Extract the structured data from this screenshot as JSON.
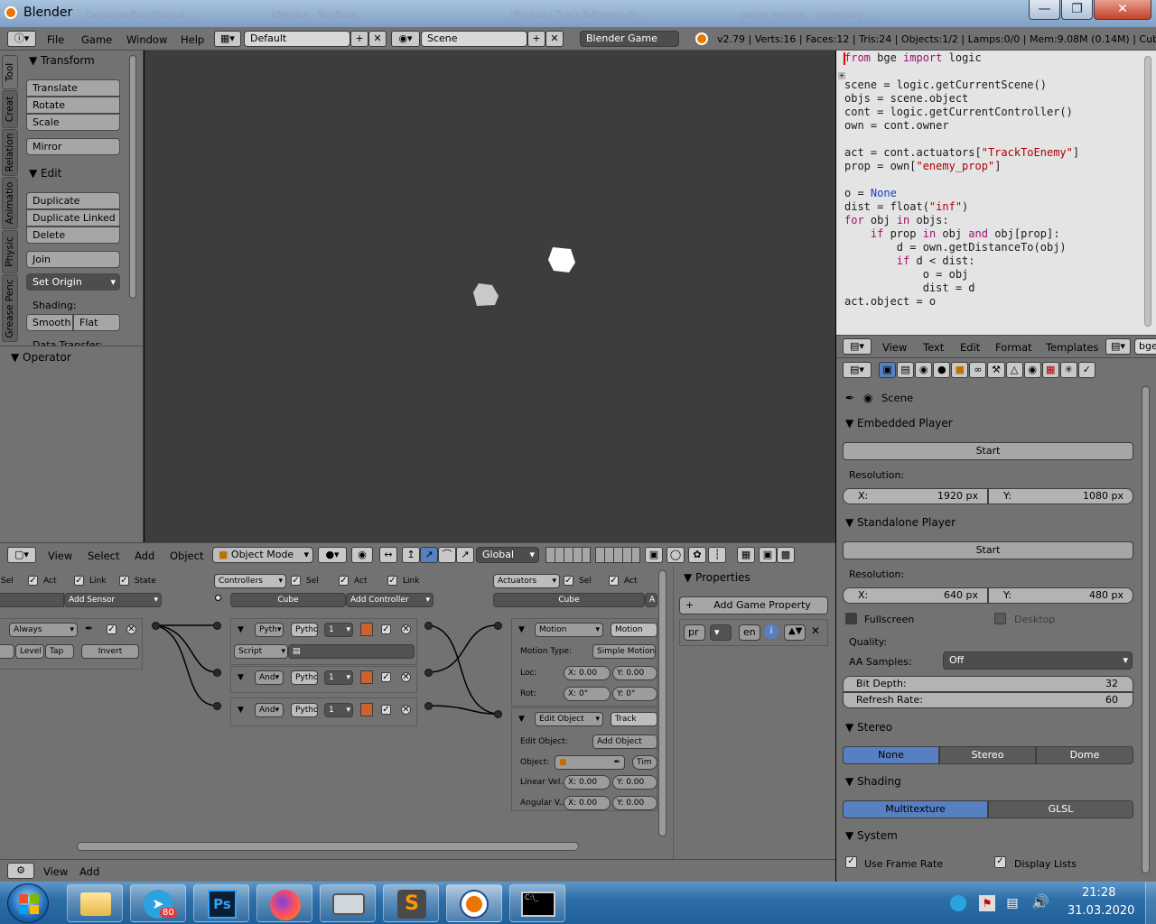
{
  "window": {
    "title": "Blender",
    "ghost_tabs": [
      "Dowolne/fontFallout ...",
      "VMedia - YouTube",
      "[Python] TrackToEnemy/b ...",
      "game engine - Inventory ..."
    ]
  },
  "menu": {
    "items": [
      "File",
      "Game",
      "Window",
      "Help"
    ]
  },
  "header": {
    "layout": "Default",
    "scene": "Scene",
    "engine": "Blender Game",
    "stats": "v2.79 | Verts:16 | Faces:12 | Tris:24 | Objects:1/2 | Lamps:0/0 | Mem:9.08M (0.14M) | Cube"
  },
  "toolshelf": {
    "tabs": [
      "Tool",
      "Creat",
      "Relation",
      "Animatio",
      "Physic",
      "Grease Penc"
    ],
    "transform": {
      "title": "Transform",
      "buttons": [
        "Translate",
        "Rotate",
        "Scale",
        "Mirror"
      ]
    },
    "edit": {
      "title": "Edit",
      "buttons": [
        "Duplicate",
        "Duplicate Linked",
        "Delete",
        "Join"
      ],
      "set_origin": "Set Origin"
    },
    "shading": {
      "label": "Shading:",
      "smooth": "Smooth",
      "flat": "Flat"
    },
    "data_transfer": "Data Transfer:",
    "operator": "Operator"
  },
  "viewport_header": {
    "menus": [
      "View",
      "Select",
      "Add",
      "Object"
    ],
    "mode": "Object Mode",
    "orientation": "Global"
  },
  "logic": {
    "sensors": {
      "sel": "Sel",
      "act": "Act",
      "link": "Link",
      "state": "State",
      "add": "Add Sensor",
      "always": "Always",
      "level": "Level",
      "tap": "Tap",
      "invert": "Invert"
    },
    "controllers": {
      "header": "Controllers",
      "sel": "Sel",
      "act": "Act",
      "link": "Link",
      "object": "Cube",
      "add": "Add Controller",
      "items": [
        {
          "type": "Pyth",
          "name": "Pytho",
          "num": "1"
        },
        {
          "type": "And",
          "name": "Pytho",
          "num": "1"
        },
        {
          "type": "And",
          "name": "Pytho",
          "num": "1"
        }
      ],
      "script_mode": "Script"
    },
    "actuators": {
      "header": "Actuators",
      "sel": "Sel",
      "act": "Act",
      "object": "Cube",
      "add": "A",
      "motion": {
        "type": "Motion",
        "name": "Motion",
        "motion_type_label": "Motion Type:",
        "motion_type": "Simple Motion",
        "loc_label": "Loc:",
        "loc_x": "X: 0.00",
        "loc_y": "Y: 0.00",
        "rot_label": "Rot:",
        "rot_x": "X: 0°",
        "rot_y": "Y: 0°"
      },
      "edit": {
        "type": "Edit Object",
        "name": "Track",
        "edit_label": "Edit Object:",
        "edit_value": "Add Object",
        "object_label": "Object:",
        "tim": "Tim",
        "linvel_label": "Linear Vel...",
        "linvel_x": "X: 0.00",
        "linvel_y": "Y: 0.00",
        "angvel_label": "Angular V...",
        "angvel_x": "X: 0.00",
        "angvel_y": "Y: 0.00"
      }
    },
    "properties": {
      "title": "Properties",
      "add": "Add Game Property",
      "pr": "pr",
      "en": "en"
    }
  },
  "bottombar": {
    "menus": [
      "View",
      "Add"
    ]
  },
  "text_editor": {
    "lines": [
      "from bge import logic",
      "",
      "scene = logic.getCurrentScene()",
      "objs = scene.object",
      "cont = logic.getCurrentController()",
      "own = cont.owner",
      "",
      "act = cont.actuators[\"TrackToEnemy\"]",
      "prop = own[\"enemy_prop\"]",
      "",
      "o = None",
      "dist = float(\"inf\")",
      "for obj in objs:",
      "    if prop in obj and obj[prop]:",
      "        d = own.getDistanceTo(obj)",
      "        if d < dist:",
      "            o = obj",
      "            dist = d",
      "act.object = o"
    ],
    "menus": [
      "View",
      "Text",
      "Edit",
      "Format",
      "Templates"
    ],
    "file": "bge"
  },
  "properties": {
    "context": "Scene",
    "embedded": {
      "title": "Embedded Player",
      "start": "Start",
      "res_label": "Resolution:",
      "x": "1920 px",
      "y": "1080 px"
    },
    "standalone": {
      "title": "Standalone Player",
      "start": "Start",
      "res_label": "Resolution:",
      "x": "640 px",
      "y": "480 px",
      "fullscreen": "Fullscreen",
      "desktop": "Desktop"
    },
    "quality": {
      "label": "Quality:",
      "aa_label": "AA Samples:",
      "aa_value": "Off",
      "bit_depth_label": "Bit Depth:",
      "bit_depth": "32",
      "refresh_label": "Refresh Rate:",
      "refresh": "60"
    },
    "stereo": {
      "title": "Stereo",
      "options": [
        "None",
        "Stereo",
        "Dome"
      ],
      "selected": "None"
    },
    "shading": {
      "title": "Shading",
      "options": [
        "Multitexture",
        "GLSL"
      ],
      "selected": "Multitexture"
    },
    "system": {
      "title": "System",
      "use_frame_rate": "Use Frame Rate",
      "display_lists": "Display Lists"
    }
  },
  "taskbar": {
    "badge": "80",
    "time": "21:28",
    "date": "31.03.2020"
  }
}
